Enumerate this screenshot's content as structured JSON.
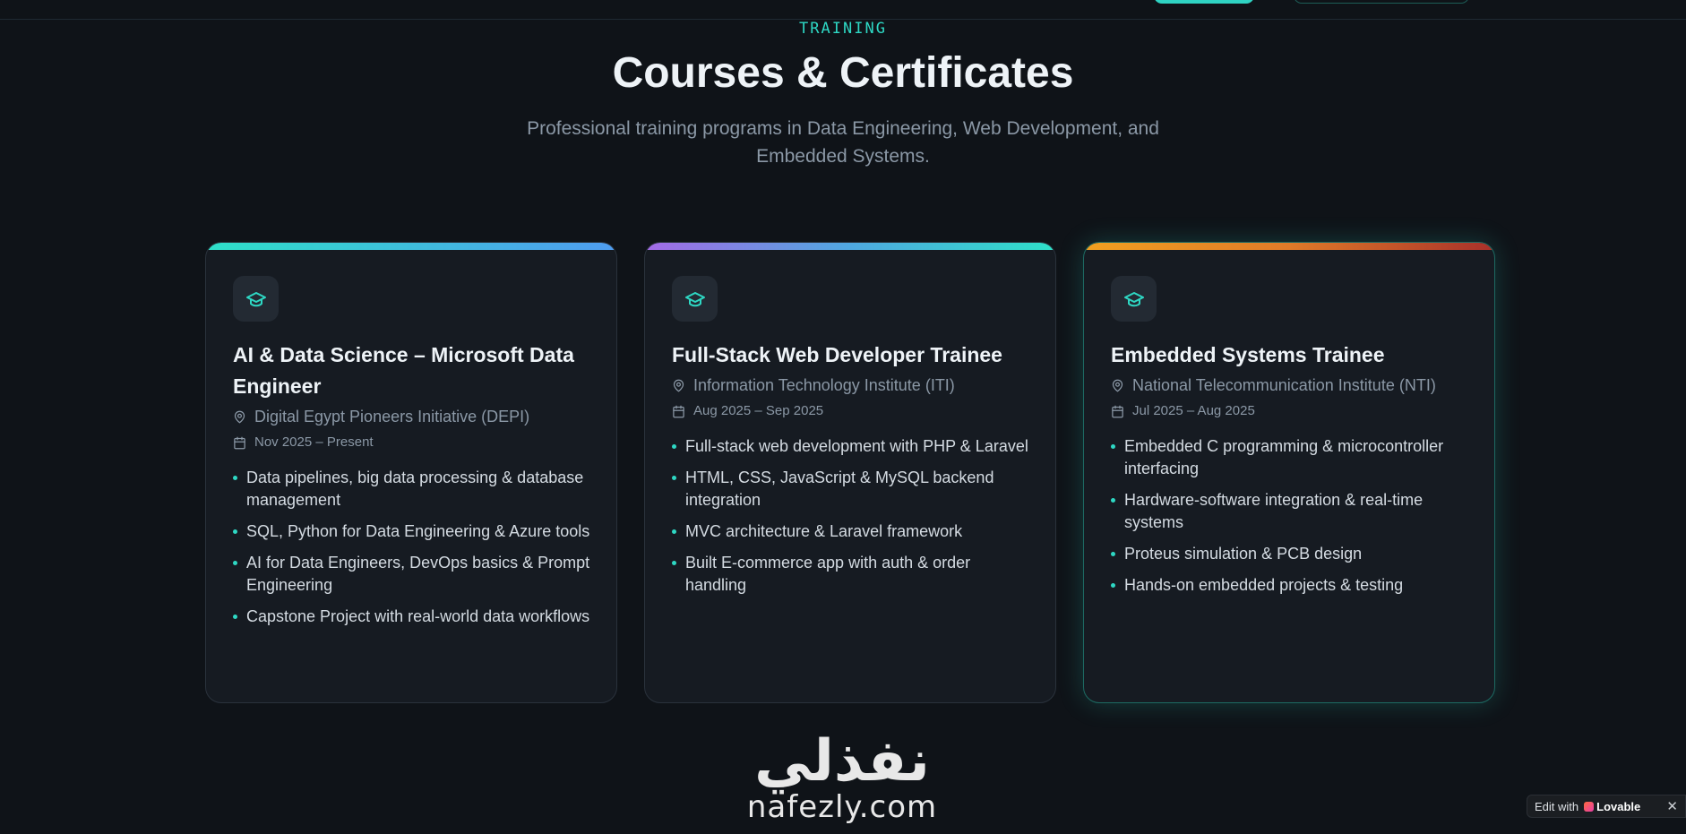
{
  "header": {
    "eyebrow": "TRAINING",
    "title": "Courses & Certificates",
    "subtitle": "Professional training programs in Data Engineering, Web Development, and Embedded Systems."
  },
  "cards": [
    {
      "title": "AI & Data Science – Microsoft Data Engineer",
      "organization": "Digital Egypt Pioneers Initiative (DEPI)",
      "date": "Nov 2025 – Present",
      "accent": "#2ee0c8",
      "icon": "graduation-cap-icon",
      "bullets": [
        "Data pipelines, big data processing & database management",
        "SQL, Python for Data Engineering & Azure tools",
        "AI for Data Engineers, DevOps basics & Prompt Engineering",
        "Capstone Project with real-world data workflows"
      ]
    },
    {
      "title": "Full-Stack Web Developer Trainee",
      "organization": "Information Technology Institute (ITI)",
      "date": "Aug 2025 – Sep 2025",
      "accent": "#a46ae6",
      "icon": "graduation-cap-icon",
      "bullets": [
        "Full-stack web development with PHP & Laravel",
        "HTML, CSS, JavaScript & MySQL backend integration",
        "MVC architecture & Laravel framework",
        "Built E-commerce app with auth & order handling"
      ]
    },
    {
      "title": "Embedded Systems Trainee",
      "organization": "National Telecommunication Institute (NTI)",
      "date": "Jul 2025 – Aug 2025",
      "accent": "#f0a020",
      "icon": "graduation-cap-icon",
      "bullets": [
        "Embedded C programming & microcontroller interfacing",
        "Hardware-software integration & real-time systems",
        "Proteus simulation & PCB design",
        "Hands-on embedded projects & testing"
      ]
    }
  ],
  "watermark": {
    "arabic": "نفذلي",
    "latin": "nafezly.com"
  },
  "badge": {
    "prefix": "Edit with",
    "brand": "Lovable",
    "close": "✕"
  },
  "colors": {
    "background": "#0f1318",
    "accent": "#2ed8c4",
    "card": "#161b22"
  }
}
